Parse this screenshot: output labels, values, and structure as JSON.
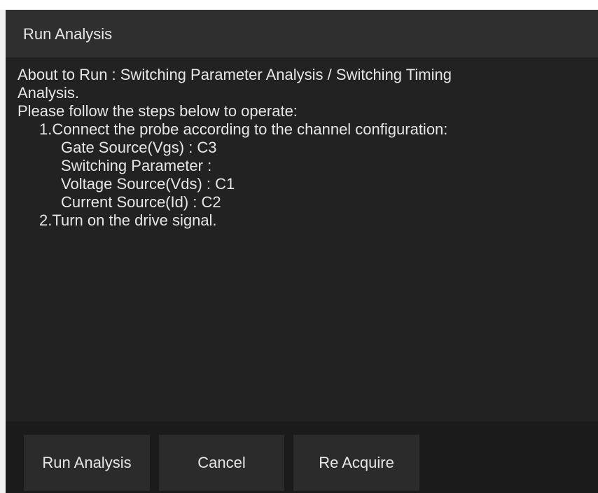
{
  "dialog": {
    "title": "Run Analysis",
    "message": {
      "line1": "About to Run : Switching Parameter Analysis / Switching Timing",
      "line2": "Analysis.",
      "line3": "Please follow the steps below to operate:",
      "step1": "1.Connect the probe according to the channel configuration:",
      "gate_source": "Gate Source(Vgs) : C3",
      "switching_parameter": "Switching Parameter :",
      "voltage_source": "Voltage Source(Vds) : C1",
      "current_source": "Current Source(Id) : C2",
      "step2": "2.Turn on the drive signal."
    },
    "buttons": {
      "run_label": "Run Analysis",
      "cancel_label": "Cancel",
      "reacquire_label": "Re Acquire"
    }
  }
}
